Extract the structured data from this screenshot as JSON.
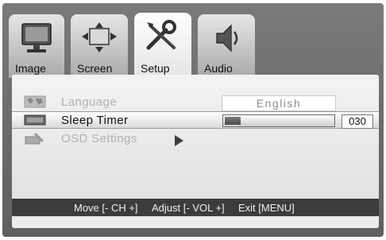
{
  "tabs": [
    {
      "label": "Image",
      "icon": "monitor-icon",
      "active": false
    },
    {
      "label": "Screen",
      "icon": "screen-arrows-icon",
      "active": false
    },
    {
      "label": "Setup",
      "icon": "tools-icon",
      "active": true
    },
    {
      "label": "Audio",
      "icon": "speaker-icon",
      "active": false
    }
  ],
  "menu": {
    "language": {
      "label": "Language",
      "value": "English",
      "icon": "globe-map-icon"
    },
    "sleep_timer": {
      "label": "Sleep Timer",
      "value": "030",
      "icon": "timer-icon",
      "level_fraction": 0.15
    },
    "osd_settings": {
      "label": "OSD Settings",
      "icon": "osd-settings-icon"
    }
  },
  "footer": {
    "move": "Move [- CH +]",
    "adjust": "Adjust [- VOL +]",
    "exit": "Exit [MENU]"
  },
  "colors": {
    "frame": "#6b6b6b",
    "footer_bg": "#3c3c3c",
    "dim_text": "#b2b2b2"
  }
}
